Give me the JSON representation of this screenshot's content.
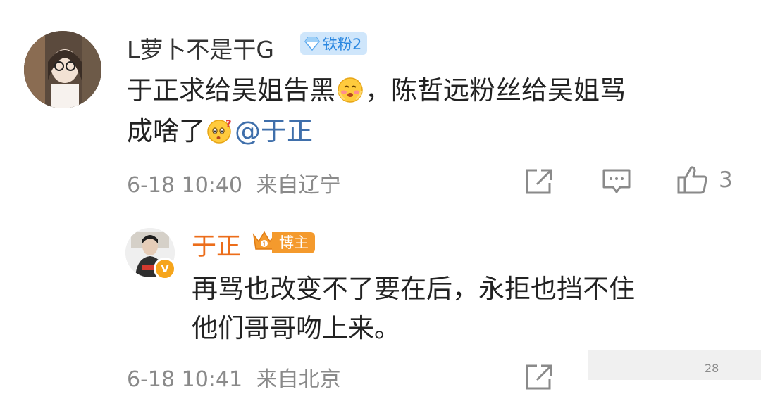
{
  "comment": {
    "username": "L萝卜不是干G",
    "fan_badge": "铁粉2",
    "text_1": "于正求给吴姐告黑",
    "text_2": "，陈哲远粉丝给吴姐骂",
    "text_3": "成啥了",
    "mention": "@于正",
    "timestamp": "6-18 10:40",
    "location": "来自辽宁",
    "like_count": "3",
    "icons": [
      "share-icon",
      "comment-icon",
      "like-icon"
    ]
  },
  "reply": {
    "username": "于正",
    "host_badge": "博主",
    "line_1": "再骂也改变不了要在后，永拒也挡不住",
    "line_2": "他们哥哥吻上来。",
    "timestamp": "6-18 10:41",
    "location": "来自北京",
    "like_count": "28"
  },
  "colors": {
    "username_reply": "#ec6d1a",
    "mention": "#3f6fab",
    "fan_badge_bg": "#cfe6fb",
    "host_badge_bg": "#f49a2d",
    "meta": "#8a8a8a"
  }
}
